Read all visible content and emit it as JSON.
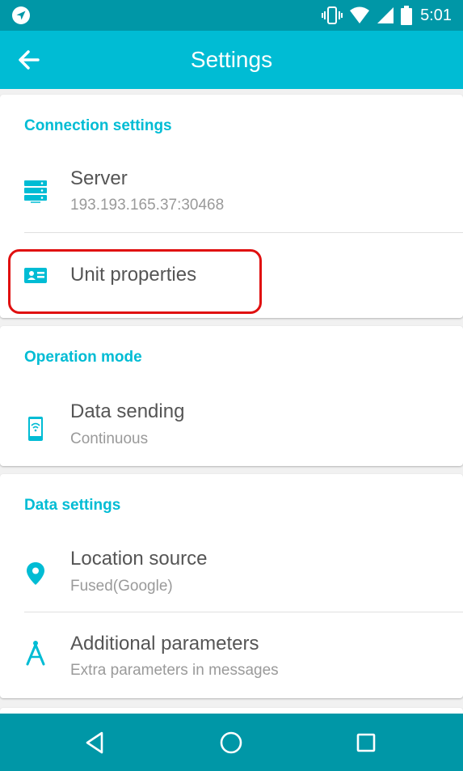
{
  "status_bar": {
    "time": "5:01",
    "icons": [
      "navigation-app-icon",
      "vibrate-icon",
      "wifi-icon",
      "cell-signal-icon",
      "battery-icon"
    ]
  },
  "app_bar": {
    "title": "Settings",
    "back_icon": "arrow-back-icon"
  },
  "sections": {
    "connection": {
      "title": "Connection settings",
      "server": {
        "label": "Server",
        "value": "193.193.165.37:30468",
        "icon": "server-icon"
      },
      "unit_properties": {
        "label": "Unit properties",
        "icon": "id-card-icon"
      }
    },
    "operation": {
      "title": "Operation mode",
      "data_sending": {
        "label": "Data sending",
        "value": "Continuous",
        "icon": "phone-wifi-icon"
      }
    },
    "data": {
      "title": "Data settings",
      "location_source": {
        "label": "Location source",
        "value": "Fused(Google)",
        "icon": "location-pin-icon"
      },
      "additional_parameters": {
        "label": "Additional parameters",
        "value": "Extra parameters in messages",
        "icon": "compass-tool-icon"
      }
    }
  },
  "nav_bar": {
    "icons": [
      "back-triangle-icon",
      "home-circle-icon",
      "recents-square-icon"
    ]
  },
  "colors": {
    "status_bar": "#0097a7",
    "app_bar": "#00bcd4",
    "accent": "#00bcd4",
    "nav_bar": "#0097a7",
    "highlight": "#e01010"
  }
}
